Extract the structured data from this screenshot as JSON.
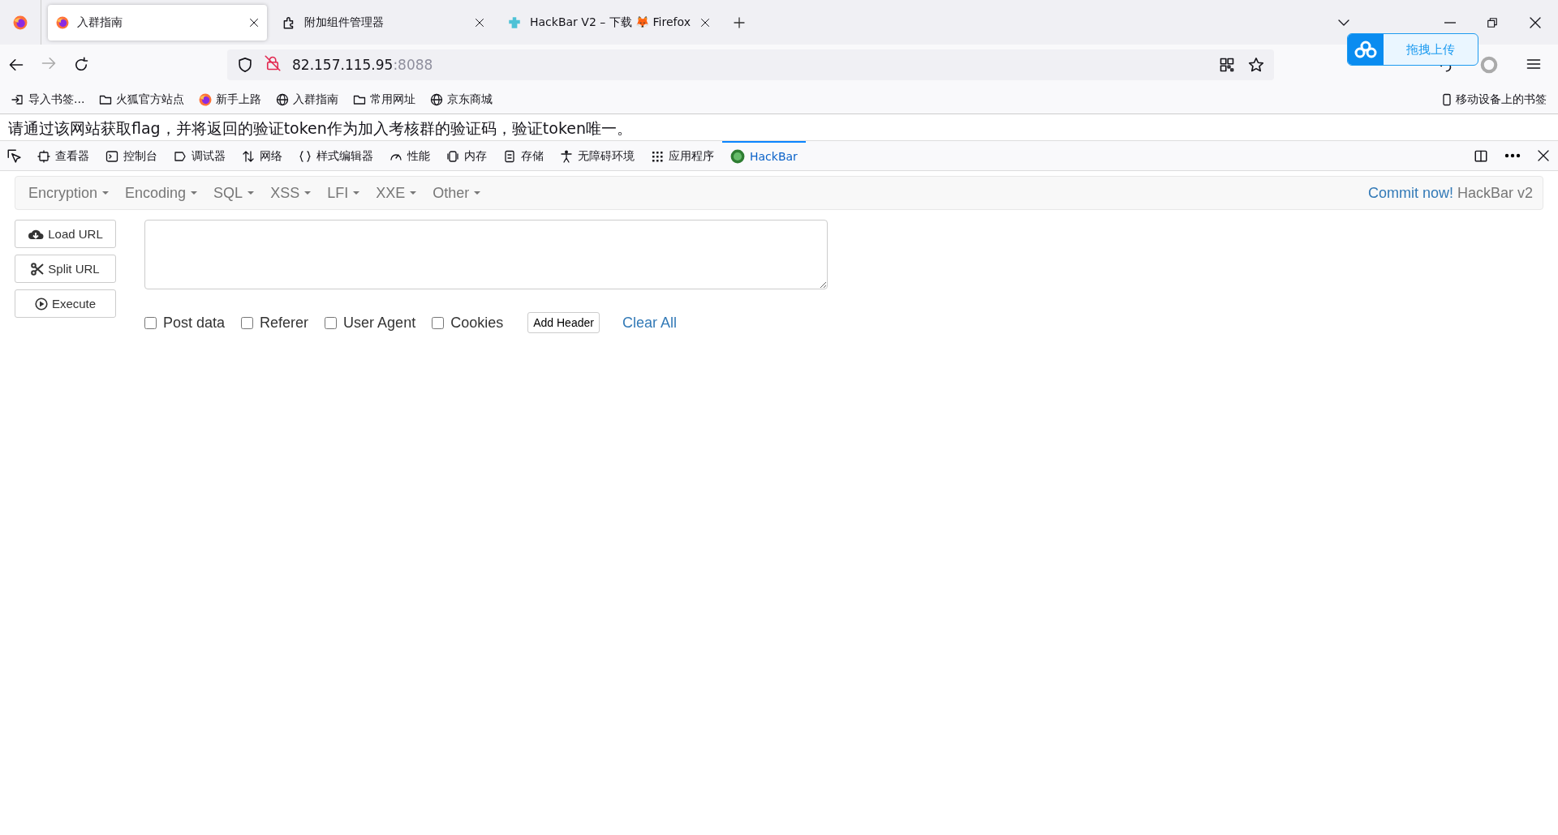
{
  "tabs": [
    {
      "title": "入群指南",
      "selected": true
    },
    {
      "title": "附加组件管理器",
      "selected": false
    },
    {
      "title": "HackBar V2 – 下载 🦊 Firefox",
      "selected": false
    }
  ],
  "address": {
    "host": "82.157.115.95",
    "port": ":8088"
  },
  "bookmarks": [
    {
      "label": "导入书签..."
    },
    {
      "label": "火狐官方站点"
    },
    {
      "label": "新手上路"
    },
    {
      "label": "入群指南"
    },
    {
      "label": "常用网址"
    },
    {
      "label": "京东商城"
    }
  ],
  "mobile_bookmarks": "移动设备上的书签",
  "upload_popup": "拖拽上传",
  "page_text": "请通过该网站获取flag，并将返回的验证token作为加入考核群的验证码，验证token唯一。",
  "devtools_tabs": [
    {
      "label": "查看器",
      "selected": false
    },
    {
      "label": "控制台",
      "selected": false
    },
    {
      "label": "调试器",
      "selected": false
    },
    {
      "label": "网络",
      "selected": false
    },
    {
      "label": "样式编辑器",
      "selected": false
    },
    {
      "label": "性能",
      "selected": false
    },
    {
      "label": "内存",
      "selected": false
    },
    {
      "label": "存储",
      "selected": false
    },
    {
      "label": "无障碍环境",
      "selected": false
    },
    {
      "label": "应用程序",
      "selected": false
    },
    {
      "label": "HackBar",
      "selected": true
    }
  ],
  "hackbar": {
    "menus": [
      "Encryption",
      "Encoding",
      "SQL",
      "XSS",
      "LFI",
      "XXE",
      "Other"
    ],
    "commit_link": "Commit now!",
    "version": "HackBar v2",
    "buttons": [
      "Load URL",
      "Split URL",
      "Execute"
    ],
    "options": [
      {
        "label": "Post data",
        "checked": false
      },
      {
        "label": "Referer",
        "checked": false
      },
      {
        "label": "User Agent",
        "checked": false
      },
      {
        "label": "Cookies",
        "checked": false
      }
    ],
    "add_header": "Add Header",
    "clear_all": "Clear All"
  }
}
